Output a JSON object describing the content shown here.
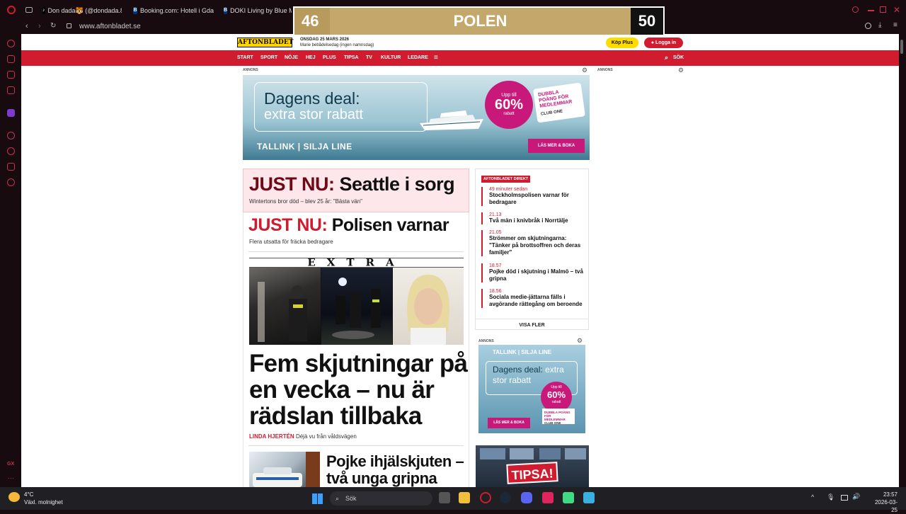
{
  "browser": {
    "tabs": [
      {
        "label": "Don dada🐯 (@dondada.8",
        "icon": "tiktok-icon"
      },
      {
        "label": "Booking.com: Hotell i Gda",
        "icon": "booking-icon"
      },
      {
        "label": "DOKI Living by Blue M",
        "icon": "booking-icon"
      }
    ],
    "url": "www.aftonbladet.se"
  },
  "scoreboard": {
    "left": "46",
    "title": "POLEN",
    "right": "50"
  },
  "site": {
    "logo": "AFTONBLADET",
    "date": "ONSDAG 25 MARS 2026",
    "nameday": "Marie bebådelsedag (ingen namnsdag)",
    "kop_plus": "Köp Plus",
    "logga_in": "Logga in",
    "nav": [
      "START",
      "SPORT",
      "NÖJE",
      "HEJ",
      "PLUS",
      "TIPSA",
      "TV",
      "KULTUR",
      "LEDARE"
    ],
    "menu_icon": "≡",
    "search": "SÖK",
    "annons": "ANNONS"
  },
  "ad_top": {
    "h1": "Dagens deal:",
    "h2": "extra stor rabatt",
    "upp_till": "Upp till",
    "percent": "60%",
    "rabatt": "rabatt",
    "tag": "DUBBLA POÄNG FÖR MEDLEMMAR",
    "club": "CLUB ONE",
    "brand": "TALLINK | SILJA LINE",
    "cta": "LÄS MER & BOKA"
  },
  "main": {
    "just1_label": "JUST NU:",
    "just1_text": "Seattle i sorg",
    "just1_sub": "Wintertons bror död – blev 25 år: \"Bästa vän\"",
    "just2_label": "JUST NU:",
    "just2_text": "Polisen varnar",
    "just2_sub": "Flera utsatta för fräcka bedragare",
    "extra": "EXTRA",
    "headline": "Fem skjutningar på en vecka – nu är rädslan tillbaka",
    "author": "LINDA HJERTÉN",
    "byline": "Déjà vu från våldsvägen",
    "headline2": "Pojke ihjälskjuten – två unga gripna"
  },
  "direkt": {
    "label": "AFTONBLADET DIREKT",
    "items": [
      {
        "time": "49 minuter sedan",
        "text": "Stockholmspolisen varnar för bedragare"
      },
      {
        "time": "21.13",
        "text": "Två män i knivbråk i Norrtälje"
      },
      {
        "time": "21.05",
        "text": "Strömmer om skjutningarna: \"Tänker på brottsoffren och deras familjer\""
      },
      {
        "time": "18.57",
        "text": "Pojke död i skjutning i Malmö – två gripna"
      },
      {
        "time": "18.56",
        "text": "Sociala medie-jättarna fälls i avgörande rättegång om beroende"
      }
    ],
    "visa_fler": "VISA FLER"
  },
  "ad_side": {
    "brand": "TALLINK | SILJA LINE",
    "h1": "Dagens deal:",
    "h1b": "extra",
    "h2": "stor rabatt",
    "upp_till": "Upp till",
    "percent": "60%",
    "rabatt": "rabatt",
    "tag": "DUBBLA POÄNG FÖR MEDLEMMAR",
    "club": "CLUB ONE",
    "cta": "LÄS MER & BOKA"
  },
  "tipsa": {
    "label": "TIPSA!"
  },
  "taskbar": {
    "temp": "4°C",
    "weather": "Växl. molnighet",
    "search": "Sök",
    "time": "23:57",
    "date": "2026-03-25"
  },
  "colors": {
    "brand_red": "#d11b2f",
    "ad_pink": "#c8197a",
    "logo_yellow": "#ffd400"
  }
}
